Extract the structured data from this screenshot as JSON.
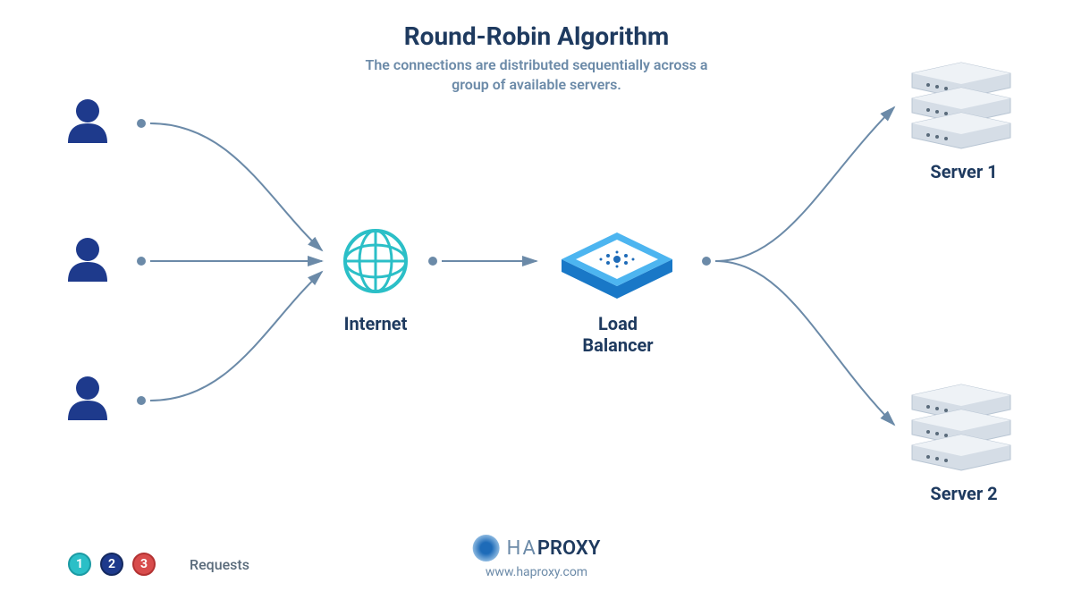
{
  "title": "Round-Robin Algorithm",
  "subtitle": "The connections are distributed sequentially across a group of available servers.",
  "nodes": {
    "internet": "Internet",
    "load_balancer": "Load\nBalancer",
    "server1": "Server 1",
    "server2": "Server 2"
  },
  "legend": {
    "items": [
      "1",
      "2",
      "3"
    ],
    "label": "Requests"
  },
  "brand": {
    "name_pre": "HA",
    "name_post": "PROXY",
    "url": "www.haproxy.com"
  },
  "colors": {
    "navy": "#1e3a5f",
    "slate": "#6b8aa8",
    "teal": "#2bbfc7",
    "blue": "#3498db",
    "arrow": "#6b8aa8"
  }
}
